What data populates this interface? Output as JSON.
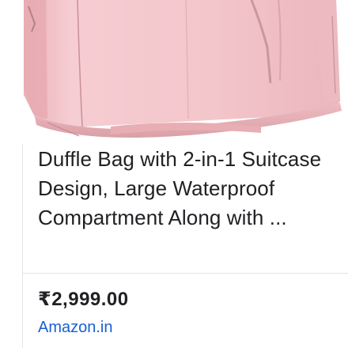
{
  "product": {
    "image_icon": "pink-duffle-bag-photo",
    "title": "Duffle Bag with 2-in-1 Suitcase Design, Large Waterproof Compartment Along with ...",
    "price": "₹2,999.00",
    "source": "Amazon.in"
  },
  "colors": {
    "bag_pink": "#f2c4c9",
    "title_text": "#202124",
    "link_blue": "#1a5fd1"
  }
}
